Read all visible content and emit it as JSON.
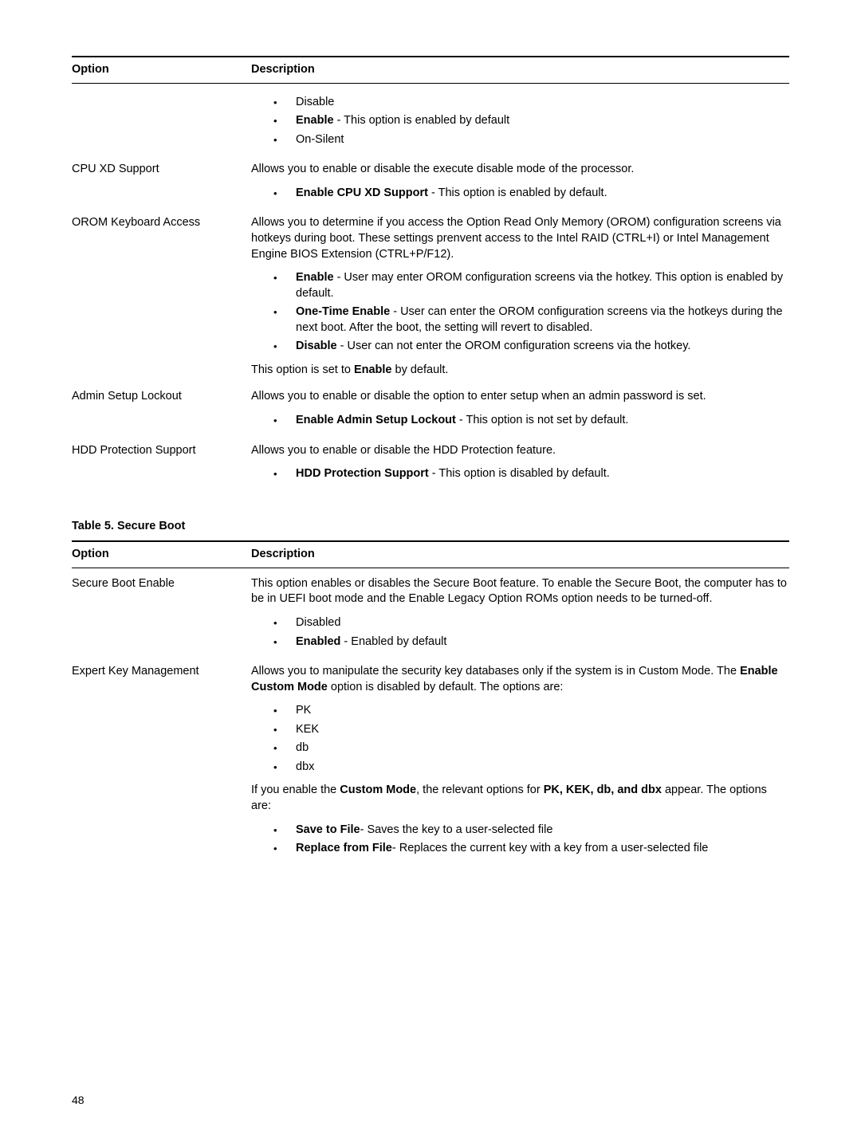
{
  "table1": {
    "headers": {
      "option": "Option",
      "description": "Description"
    },
    "rows": {
      "r0": {
        "items": {
          "i0": "Disable",
          "i1b": "Enable",
          "i1r": " - This option is enabled by default",
          "i2": "On-Silent"
        }
      },
      "cpu_xd": {
        "option": "CPU XD Support",
        "p1": "Allows you to enable or disable the execute disable mode of the processor.",
        "b0b": "Enable CPU XD Support",
        "b0r": " - This option is enabled by default."
      },
      "orom": {
        "option": "OROM Keyboard Access",
        "p1": "Allows you to determine if you access the Option Read Only Memory (OROM) configuration screens via hotkeys during boot. These settings prenvent access to the Intel RAID (CTRL+I) or Intel Management Engine BIOS Extension (CTRL+P/F12).",
        "b0b": "Enable",
        "b0r": " - User may enter OROM configuration screens via the hotkey. This option is enabled by default.",
        "b1b": "One-Time Enable",
        "b1r": " - User can enter the OROM configuration screens via the hotkeys during the next boot. After the boot, the setting will revert to disabled.",
        "b2b": "Disable",
        "b2r": " - User can not enter the OROM configuration screens via the hotkey.",
        "p2a": "This option is set to ",
        "p2b": "Enable",
        "p2c": " by default."
      },
      "admin": {
        "option": "Admin Setup Lockout",
        "p1": "Allows you to enable or disable the option to enter setup when an admin password is set.",
        "b0b": "Enable Admin Setup Lockout",
        "b0r": " - This option is not set by default."
      },
      "hdd": {
        "option": "HDD Protection Support",
        "p1": "Allows you to enable or disable the HDD Protection feature.",
        "b0b": "HDD Protection Support",
        "b0r": " - This option is disabled by default."
      }
    }
  },
  "table2": {
    "caption": "Table 5. Secure Boot",
    "headers": {
      "option": "Option",
      "description": "Description"
    },
    "rows": {
      "sbe": {
        "option": "Secure Boot Enable",
        "p1": "This option enables or disables the Secure Boot feature. To enable the Secure Boot, the computer has to be in UEFI boot mode and the Enable Legacy Option ROMs option needs to be turned-off.",
        "b0": "Disabled",
        "b1b": "Enabled",
        "b1r": " - Enabled by default"
      },
      "ekm": {
        "option": "Expert Key Management",
        "p1a": "Allows you to manipulate the security key databases only if the system is in Custom Mode. The ",
        "p1b": "Enable Custom Mode",
        "p1c": " option is disabled by default. The options are:",
        "b0": "PK",
        "b1": "KEK",
        "b2": "db",
        "b3": "dbx",
        "p2a": "If you enable the ",
        "p2b": "Custom Mode",
        "p2c": ", the relevant options for ",
        "p2d": "PK, KEK, db, and dbx",
        "p2e": " appear. The options are:",
        "c0b": "Save to File",
        "c0r": "- Saves the key to a user-selected file",
        "c1b": "Replace from File",
        "c1r": "- Replaces the current key with a key from a user-selected file"
      }
    }
  },
  "page_number": "48"
}
